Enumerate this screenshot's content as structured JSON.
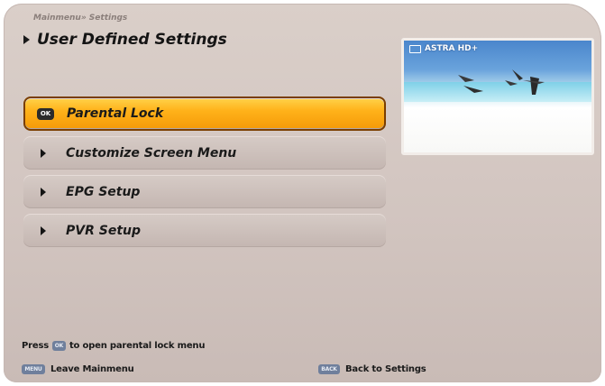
{
  "breadcrumb": "Mainmenu» Settings",
  "title": "User Defined Settings",
  "preview": {
    "channel": "ASTRA HD+"
  },
  "menu": {
    "items": [
      {
        "label": "Parental Lock",
        "selected": true,
        "button": "OK"
      },
      {
        "label": "Customize Screen Menu",
        "selected": false
      },
      {
        "label": "EPG Setup",
        "selected": false
      },
      {
        "label": "PVR Setup",
        "selected": false
      }
    ]
  },
  "hint": {
    "prefix": "Press",
    "key": "OK",
    "suffix": "to open parental lock menu"
  },
  "footer": {
    "left_key": "MENU",
    "left_label": "Leave Mainmenu",
    "right_key": "BACK",
    "right_label": "Back to Settings"
  },
  "colors": {
    "selected_top": "#ffd24a",
    "selected_bottom": "#f59a08",
    "panel": "#d2c5c0",
    "key_blue": "#6f7f9c"
  }
}
